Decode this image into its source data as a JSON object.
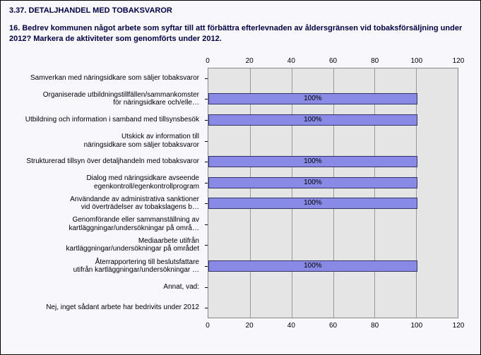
{
  "section_title": "3.37. DETALJHANDEL MED TOBAKSVAROR",
  "question": "16. Bedrev kommunen något arbete som syftar till att förbättra efterlevnaden av åldersgränsen vid tobaksförsäljning under 2012? Markera de aktiviteter som genomförts under 2012.",
  "chart_data": {
    "type": "bar",
    "orientation": "horizontal",
    "xlim": [
      0,
      120
    ],
    "xticks": [
      0,
      20,
      40,
      60,
      80,
      100,
      120
    ],
    "categories": [
      "Samverkan med näringsidkare som säljer tobaksvaror",
      "Organiserade utbildningstillfällen/sammankomster för näringsidkare och/elle…",
      "Utbildning och information i samband med tillsynsbesök",
      "Utskick av information till näringsidkare som säljer tobaksvaror",
      "Strukturerad tillsyn över detaljhandeln med tobaksvaror",
      "Dialog med näringsidkare avseende egenkontroll/egenkontrollprogram",
      "Användande av administrativa sanktioner vid överträdelser av tobakslagens b…",
      "Genomförande eller sammanställning av kartläggningar/undersökningar på områ…",
      "Mediaarbete utifrån kartläggningar/undersökningar på området",
      "Återrapportering till beslutsfattare utifrån kartläggningar/undersökningar …",
      "Annat, vad:",
      "Nej, inget sådant arbete har bedrivits under 2012"
    ],
    "category_lines": [
      [
        "Samverkan med näringsidkare som säljer tobaksvaror"
      ],
      [
        "Organiserade utbildningstillfällen/sammankomster",
        "för näringsidkare och/elle…"
      ],
      [
        "Utbildning och information i samband med tillsynsbesök"
      ],
      [
        "Utskick av information till",
        "näringsidkare som säljer tobaksvaror"
      ],
      [
        "Strukturerad tillsyn över detaljhandeln med tobaksvaror"
      ],
      [
        "Dialog med näringsidkare avseende",
        "egenkontroll/egenkontrollprogram"
      ],
      [
        "Användande av administrativa sanktioner",
        "vid överträdelser av tobakslagens b…"
      ],
      [
        "Genomförande eller sammanställning av",
        "kartläggningar/undersökningar på områ…"
      ],
      [
        "Mediaarbete utifrån",
        "kartläggningar/undersökningar på området"
      ],
      [
        "Återrapportering till beslutsfattare",
        "utifrån kartläggningar/undersökningar …"
      ],
      [
        "Annat, vad:"
      ],
      [
        "Nej, inget sådant arbete har bedrivits under 2012"
      ]
    ],
    "values": [
      0,
      100,
      100,
      0,
      100,
      100,
      100,
      0,
      0,
      100,
      0,
      0
    ],
    "value_labels": [
      "",
      "100%",
      "100%",
      "",
      "100%",
      "100%",
      "100%",
      "",
      "",
      "100%",
      "",
      ""
    ]
  }
}
